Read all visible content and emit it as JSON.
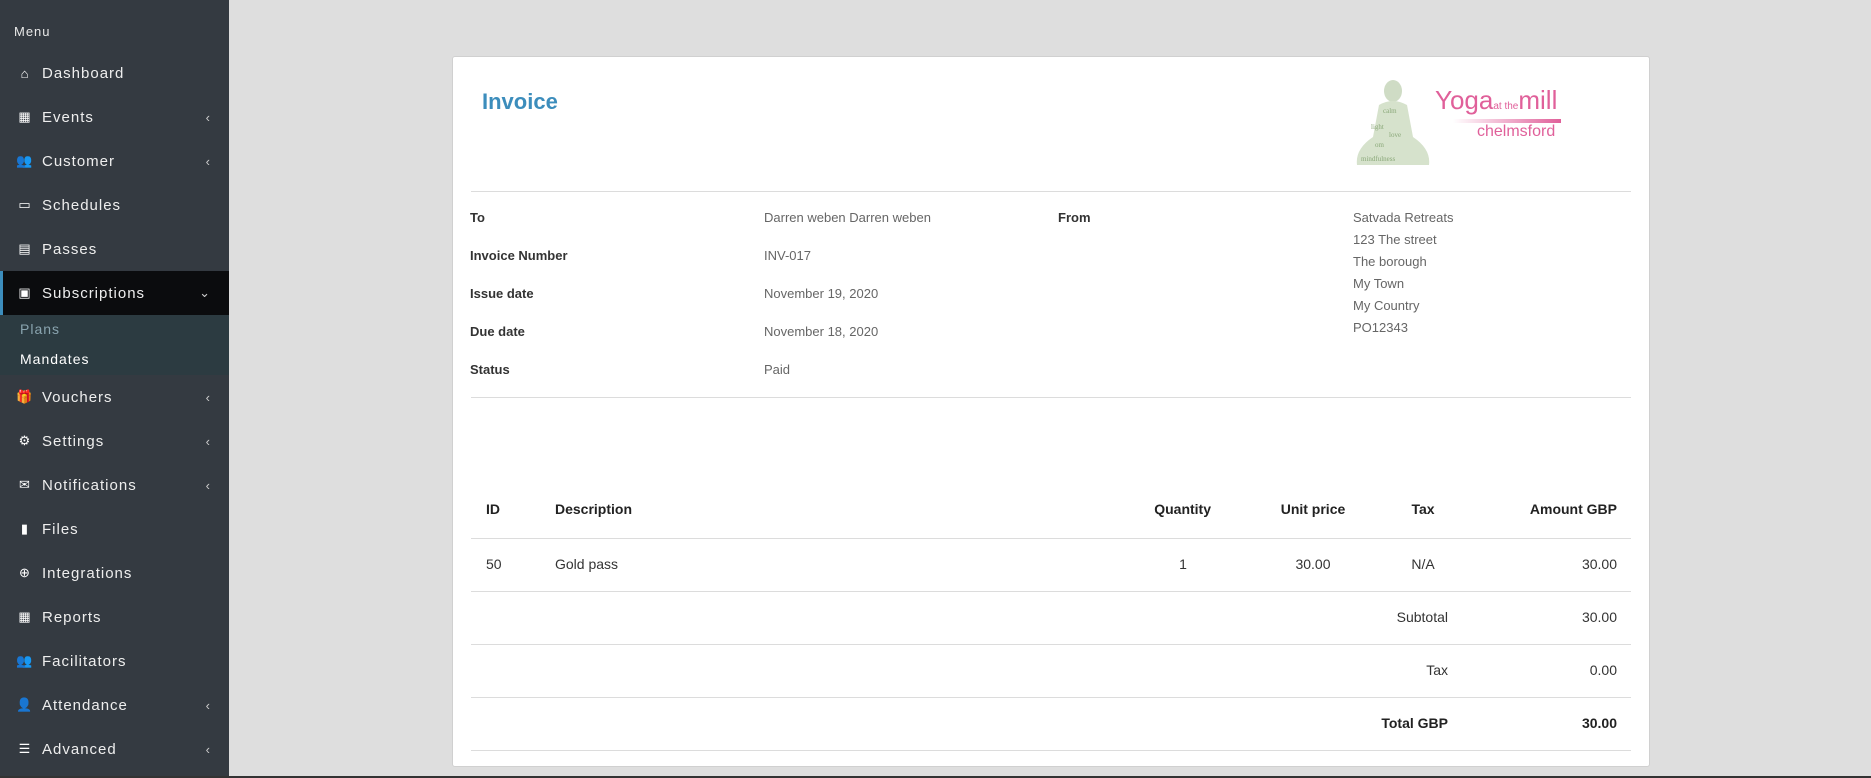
{
  "sidebar": {
    "heading": "Menu",
    "items": [
      {
        "label": "Dashboard",
        "icon": "home-icon",
        "glyph": "⌂",
        "chevron": ""
      },
      {
        "label": "Events",
        "icon": "calendar-icon",
        "glyph": "▦",
        "chevron": "‹"
      },
      {
        "label": "Customer",
        "icon": "users-icon",
        "glyph": "👥",
        "chevron": "‹"
      },
      {
        "label": "Schedules",
        "icon": "calendar-empty-icon",
        "glyph": "▭",
        "chevron": ""
      },
      {
        "label": "Passes",
        "icon": "file-text-icon",
        "glyph": "▤",
        "chevron": ""
      },
      {
        "label": "Subscriptions",
        "icon": "id-card-icon",
        "glyph": "▣",
        "chevron": "⌄"
      },
      {
        "label": "Vouchers",
        "icon": "gift-icon",
        "glyph": "🎁",
        "chevron": "‹"
      },
      {
        "label": "Settings",
        "icon": "cogs-icon",
        "glyph": "⚙",
        "chevron": "‹"
      },
      {
        "label": "Notifications",
        "icon": "envelope-icon",
        "glyph": "✉",
        "chevron": "‹"
      },
      {
        "label": "Files",
        "icon": "file-icon",
        "glyph": "▮",
        "chevron": ""
      },
      {
        "label": "Integrations",
        "icon": "plus-circle-icon",
        "glyph": "⊕",
        "chevron": ""
      },
      {
        "label": "Reports",
        "icon": "table-icon",
        "glyph": "▦",
        "chevron": ""
      },
      {
        "label": "Facilitators",
        "icon": "users-icon",
        "glyph": "👥",
        "chevron": ""
      },
      {
        "label": "Attendance",
        "icon": "user-plus-icon",
        "glyph": "👤",
        "chevron": "‹"
      },
      {
        "label": "Advanced",
        "icon": "server-icon",
        "glyph": "☰",
        "chevron": "‹"
      }
    ],
    "submenu": [
      {
        "label": "Plans",
        "color": "#8aa4af"
      },
      {
        "label": "Mandates",
        "color": "#ffffff"
      }
    ]
  },
  "invoice": {
    "title": "Invoice",
    "logo": {
      "brand": "Yoga",
      "small": "at the",
      "brand2": "mill",
      "town": "chelmsford"
    },
    "details": [
      {
        "label": "To",
        "value": "Darren weben Darren weben"
      },
      {
        "label": "Invoice Number",
        "value": "INV-017"
      },
      {
        "label": "Issue date",
        "value": "November 19, 2020"
      },
      {
        "label": "Due date",
        "value": "November 18, 2020"
      },
      {
        "label": "Status",
        "value": "Paid"
      }
    ],
    "from_label": "From",
    "from_lines": [
      "Satvada Retreats",
      "123 The street",
      "The borough",
      "My Town",
      "My Country",
      "PO12343"
    ],
    "table": {
      "headers": [
        "ID",
        "Description",
        "Quantity",
        "Unit price",
        "Tax",
        "Amount GBP"
      ],
      "rows": [
        [
          "50",
          "Gold pass",
          "1",
          "30.00",
          "N/A",
          "30.00"
        ]
      ],
      "subtotal_label": "Subtotal",
      "subtotal": "30.00",
      "tax_label": "Tax",
      "tax": "0.00",
      "total_label": "Total GBP",
      "total": "30.00"
    }
  },
  "colors": {
    "accent": "#3c8dbc",
    "sidebar": "#343a41",
    "logo": "#e0609a"
  }
}
